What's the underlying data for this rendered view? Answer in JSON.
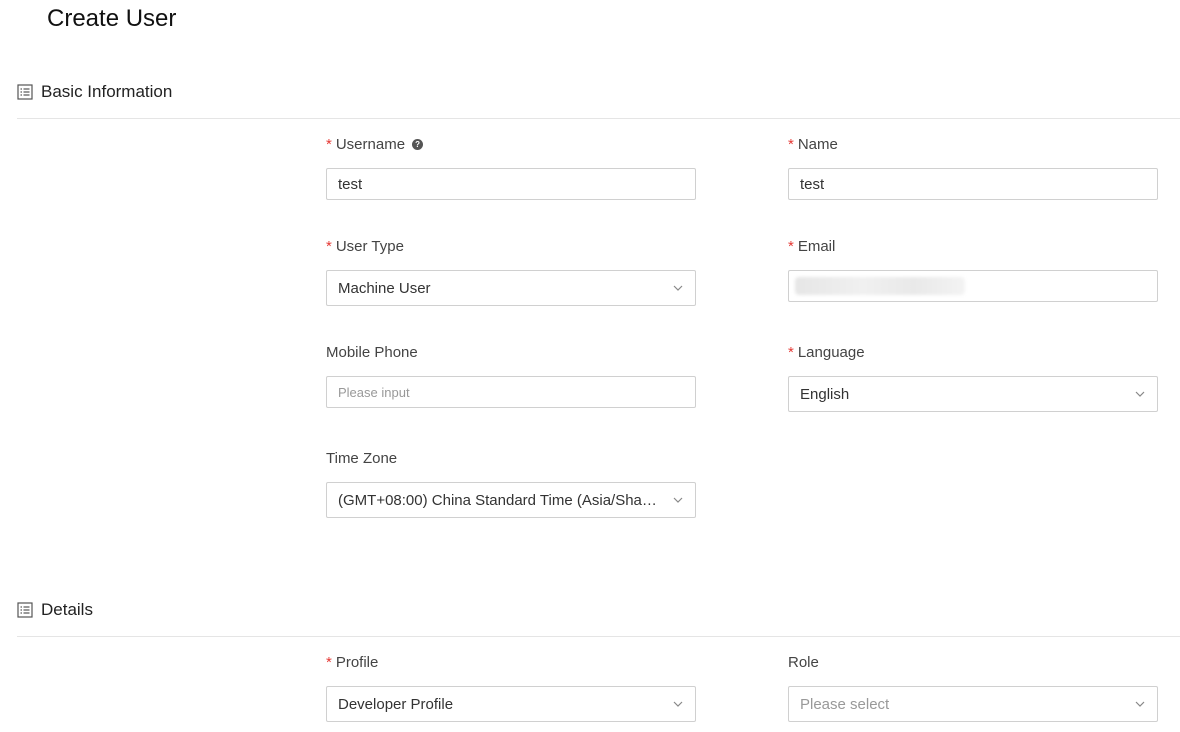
{
  "page": {
    "title": "Create User"
  },
  "sections": {
    "basic": {
      "title": "Basic Information"
    },
    "details": {
      "title": "Details"
    }
  },
  "fields": {
    "username": {
      "label": "Username",
      "value": "test",
      "required": true
    },
    "name": {
      "label": "Name",
      "value": "test",
      "required": true
    },
    "user_type": {
      "label": "User Type",
      "value": "Machine User",
      "required": true
    },
    "email": {
      "label": "Email",
      "value": "",
      "required": true
    },
    "mobile_phone": {
      "label": "Mobile Phone",
      "placeholder": "Please input",
      "required": false
    },
    "language": {
      "label": "Language",
      "value": "English",
      "required": true
    },
    "time_zone": {
      "label": "Time Zone",
      "value": "(GMT+08:00) China Standard Time (Asia/Shan...",
      "required": false
    },
    "profile": {
      "label": "Profile",
      "value": "Developer Profile",
      "required": true
    },
    "role": {
      "label": "Role",
      "placeholder": "Please select",
      "required": false
    }
  },
  "required_marker": "*",
  "icons": {
    "section": "list-icon",
    "help": "question-circle-icon",
    "dropdown": "chevron-down-icon"
  },
  "colors": {
    "required": "#e53935",
    "border": "#d0d0d0",
    "divider": "#e5e5e5"
  }
}
